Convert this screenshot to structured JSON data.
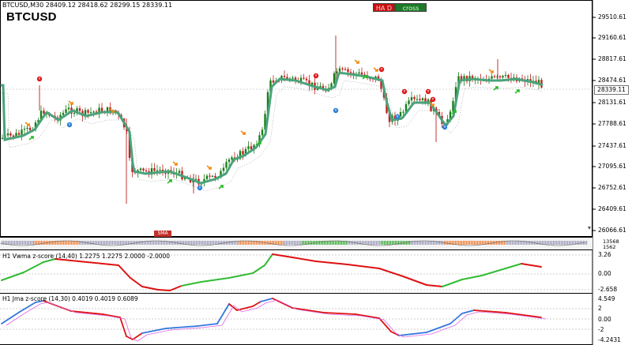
{
  "header": {
    "info": "BTCUSD,M30  28409.12 28418.62 28299.15 28339.11",
    "symbol": "BTCUSD"
  },
  "buttons": {
    "ha": "HA D",
    "cross": "cross"
  },
  "main_axis": {
    "ticks": [
      "29510.61",
      "29160.61",
      "28817.61",
      "28474.61",
      "28131.61",
      "27788.61",
      "27437.61",
      "27095.61",
      "26752.61",
      "26409.61",
      "26066.61"
    ],
    "current_price": "28339.11"
  },
  "strip": {
    "ticks": [
      "13568",
      "1562"
    ],
    "badge": "SMA"
  },
  "pane1": {
    "label": "H1 Vwma z-score (14,40) 1.2275 1.2275 2.0000 -2.0000",
    "ticks": [
      "3.26",
      "0.00",
      "-2.658"
    ]
  },
  "pane2": {
    "label": "H1 Jma z-score (14,30) 0.4019 0.4019 0.6089",
    "ticks": [
      "4.549",
      "2",
      "0.00",
      "-2",
      "-4.2431"
    ]
  },
  "colors": {
    "bull_candle": "#1a7f1a",
    "bear_candle": "#c02020",
    "ma_line": "#4aa37c",
    "osc_up": "#33bb33",
    "osc_down": "#dd1111",
    "jma_blue": "#3377dd",
    "signal_pink": "#dd66dd"
  }
}
